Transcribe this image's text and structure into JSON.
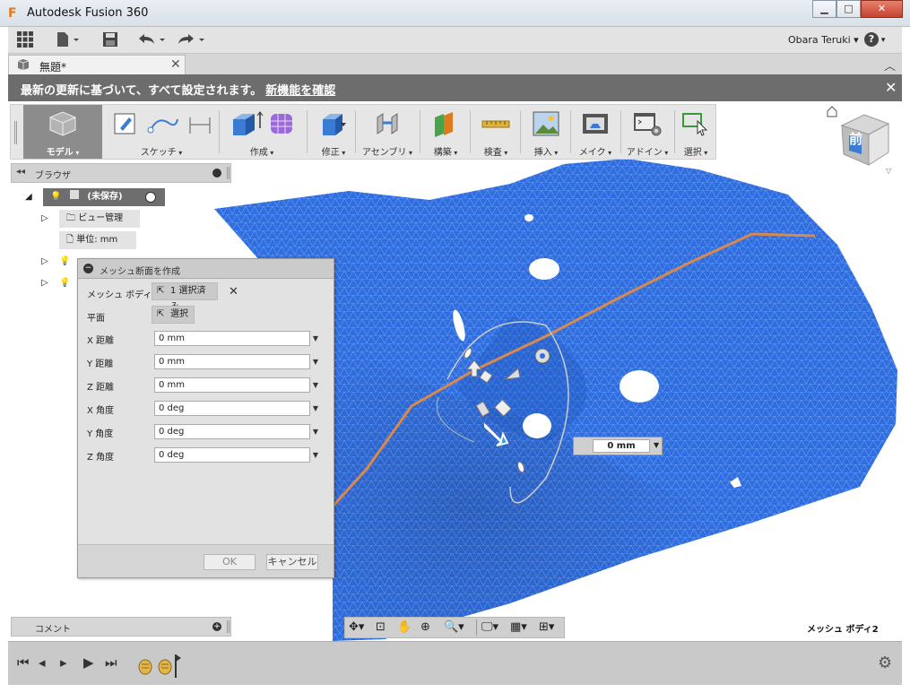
{
  "window": {
    "title": "Autodesk Fusion 360",
    "logo_letter": "F",
    "minimize": "▁",
    "maximize": "□",
    "close": "✕"
  },
  "toolbar": {
    "user_name": "Obara Teruki",
    "help": "?"
  },
  "tab": {
    "doc_label": "無題*",
    "close": "✕"
  },
  "notification": {
    "text": "最新の更新に基づいて、すべて設定されます。",
    "link": "新機能を確認",
    "close": "✕"
  },
  "ribbon": [
    {
      "label": "モデル",
      "icon": "model-cube-icon"
    },
    {
      "label": "スケッチ",
      "icon": "sketch-icon"
    },
    {
      "label": "作成",
      "icon": "create-box-icon"
    },
    {
      "label": "修正",
      "icon": "modify-icon"
    },
    {
      "label": "アセンブリ",
      "icon": "assembly-icon"
    },
    {
      "label": "構築",
      "icon": "construct-plane-icon"
    },
    {
      "label": "検査",
      "icon": "inspect-ruler-icon"
    },
    {
      "label": "挿入",
      "icon": "insert-image-icon"
    },
    {
      "label": "メイク",
      "icon": "make-print-icon"
    },
    {
      "label": "アドイン",
      "icon": "addin-icon"
    },
    {
      "label": "選択",
      "icon": "select-arrow-icon"
    }
  ],
  "browser": {
    "title": "ブラウザ",
    "root": "(未保存)",
    "items": [
      "ビュー管理",
      "単位: mm"
    ]
  },
  "dialog": {
    "title": "メッシュ断面を作成",
    "mesh_body_label": "メッシュ ボディ",
    "mesh_body_value": "1 選択済み",
    "plane_label": "平面",
    "plane_value": "選択",
    "fields": [
      {
        "label": "X 距離",
        "value": "0 mm"
      },
      {
        "label": "Y 距離",
        "value": "0 mm"
      },
      {
        "label": "Z 距離",
        "value": "0 mm"
      },
      {
        "label": "X 角度",
        "value": "0 deg"
      },
      {
        "label": "Y 角度",
        "value": "0 deg"
      },
      {
        "label": "Z 角度",
        "value": "0 deg"
      }
    ],
    "ok": "OK",
    "cancel": "キャンセル"
  },
  "viewport": {
    "float_value": "0 mm",
    "mesh_name": "メッシュ ボディ2",
    "viewcube_text": "前"
  },
  "comments": {
    "title": "コメント"
  },
  "colors": {
    "mesh_blue": "#2f6ee0",
    "section_orange": "#d9894b",
    "notification_bg": "#6d6d6d"
  }
}
